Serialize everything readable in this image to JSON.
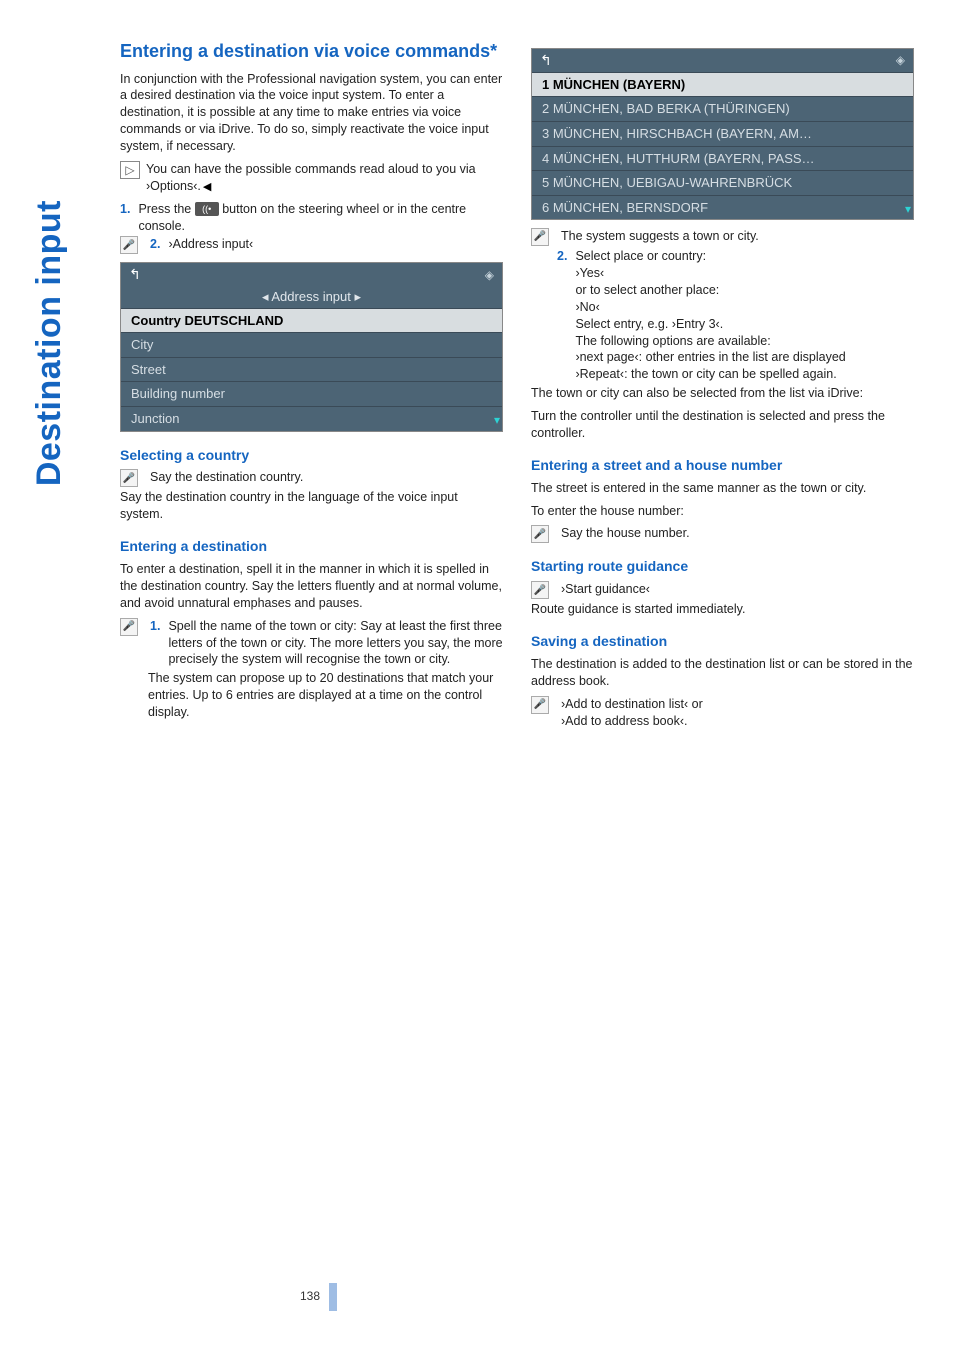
{
  "side_tab": "Destination input",
  "left": {
    "h2": "Entering a destination via voice commands*",
    "intro": "In conjunction with the Professional navigation system, you can enter a desired destination via the voice input system. To enter a destination, it is possible at any time to make entries via voice commands or via iDrive. To do so, simply reactivate the voice input system, if necessary.",
    "tip": "You can have the possible commands read aloud to you via ›Options‹.",
    "step1_a": "Press the ",
    "step1_b": " button on the steering wheel or in the centre console.",
    "step2": "›Address input‹",
    "panel1": {
      "title": "◂ Address input ▸",
      "rows": [
        "Country   DEUTSCHLAND",
        "City",
        "Street",
        "Building number",
        "Junction"
      ]
    },
    "sel_h": "Selecting a country",
    "sel_1": "Say the destination country.",
    "sel_2": "Say the destination country in the language of the voice input system.",
    "ent_h": "Entering a destination",
    "ent_p": "To enter a destination, spell it in the manner in which it is spelled in the destination country. Say the letters fluently and at normal volume, and avoid unnatural emphases and pauses.",
    "ent_s1": "Spell the name of the town or city: Say at least the first three letters of the town or city. The more letters you say, the more precisely the system will recognise the town or city.",
    "ent_after": "The system can propose up to 20 destinations that match your entries. Up to 6 entries are displayed at a time on the control display."
  },
  "right": {
    "panel2": {
      "rows": [
        "1 MÜNCHEN (BAYERN)",
        "2 MÜNCHEN, BAD BERKA (THÜRINGEN)",
        "3 MÜNCHEN, HIRSCHBACH (BAYERN, AM…",
        "4 MÜNCHEN, HUTTHURM (BAYERN, PASS…",
        "5 MÜNCHEN, UEBIGAU-WAHRENBRÜCK",
        "6 MÜNCHEN, BERNSDORF"
      ]
    },
    "sys_suggests": "The system suggests a town or city.",
    "step2_title": "Select place or country:",
    "step2_lines": [
      "›Yes‹",
      "or to select another place:",
      "›No‹",
      "Select entry, e.g. ›Entry 3‹.",
      "The following options are available:",
      "›next page‹: other entries in the list are displayed",
      "›Repeat‹: the town or city can be spelled again."
    ],
    "after2_a": "The town or city can also be selected from the list via iDrive:",
    "after2_b": "Turn the controller until the destination is selected and press the controller.",
    "street_h": "Entering a street and a house number",
    "street_p1": "The street is entered in the same manner as the town or city.",
    "street_p2": "To enter the house number:",
    "street_say": "Say the house number.",
    "startg_h": "Starting route guidance",
    "startg_cmd": "›Start guidance‹",
    "startg_p": "Route guidance is started immediately.",
    "save_h": "Saving a destination",
    "save_p": "The destination is added to the destination list or can be stored in the address book.",
    "save_cmd1": "›Add to destination list‹ or",
    "save_cmd2": "›Add to address book‹."
  },
  "page": "138"
}
